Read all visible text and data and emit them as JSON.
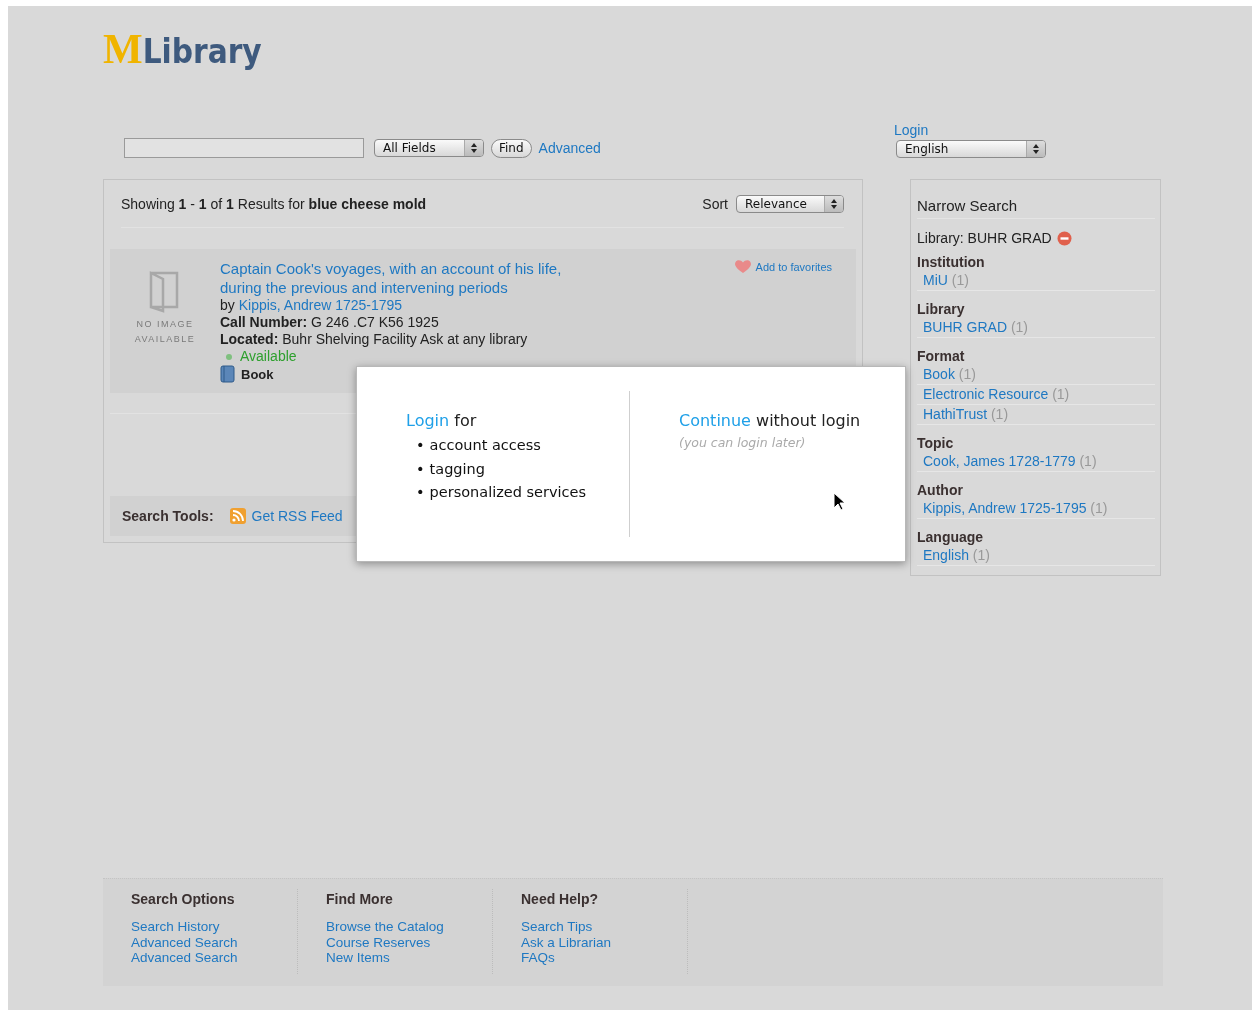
{
  "logo": {
    "mark": "M",
    "text": "Library"
  },
  "search": {
    "scope": "All Fields",
    "find_button": "Find",
    "advanced_link": "Advanced"
  },
  "account": {
    "login_link": "Login",
    "language": "English"
  },
  "results": {
    "summary": "Showing **1** - **1** of **1** Results for **blue cheese mold**",
    "sort_label": "Sort",
    "sort": "Relevance",
    "records": [
      {
        "no_image": "NO IMAGE AVAILABLE",
        "title": "Captain Cook's voyages, with an account of his life, during the previous and intervening periods",
        "by": "by",
        "author": "Kippis, Andrew 1725-1795",
        "call_number_label": "Call Number:",
        "call_number": "G 246 .C7 K56 1925",
        "located_label": "Located:",
        "located": "Buhr Shelving Facility Ask at any library",
        "status": "Available",
        "format": "Book",
        "favorite": "Add to favorites"
      }
    ],
    "tools_label": "Search Tools:",
    "tools": [
      {
        "label": "Get RSS Feed"
      }
    ]
  },
  "narrow": {
    "title": "Narrow Search",
    "applied": [
      {
        "text": "Library: BUHR GRAD"
      }
    ],
    "facets": [
      {
        "name": "Institution",
        "values": [
          {
            "label": "MiU",
            "count": "(1)"
          }
        ]
      },
      {
        "name": "Library",
        "values": [
          {
            "label": "BUHR GRAD",
            "count": "(1)"
          }
        ]
      },
      {
        "name": "Format",
        "values": [
          {
            "label": "Book",
            "count": "(1)"
          },
          {
            "label": "Electronic Resource",
            "count": "(1)"
          },
          {
            "label": "HathiTrust",
            "count": "(1)"
          }
        ]
      },
      {
        "name": "Topic",
        "values": [
          {
            "label": "Cook, James 1728-1779",
            "count": "(1)"
          }
        ]
      },
      {
        "name": "Author",
        "values": [
          {
            "label": "Kippis, Andrew 1725-1795",
            "count": "(1)"
          }
        ]
      },
      {
        "name": "Language",
        "values": [
          {
            "label": "English",
            "count": "(1)"
          }
        ]
      }
    ]
  },
  "dialog": {
    "login_link": "Login",
    "login_suffix": "for",
    "benefits": [
      {
        "bullet": "•",
        "text": "account access"
      },
      {
        "bullet": "•",
        "text": "tagging"
      },
      {
        "bullet": "•",
        "text": "personalized services"
      }
    ],
    "continue_link": "Continue",
    "continue_suffix": "without login",
    "note": "(you can login later)"
  },
  "footer": {
    "columns": [
      {
        "heading": "Search Options",
        "links": [
          "Search History",
          "Advanced Search",
          "Advanced Search"
        ]
      },
      {
        "heading": "Find More",
        "links": [
          "Browse the Catalog",
          "Course Reserves",
          "New Items"
        ]
      },
      {
        "heading": "Need Help?",
        "links": [
          "Search Tips",
          "Ask a Librarian",
          "FAQs"
        ]
      }
    ]
  }
}
